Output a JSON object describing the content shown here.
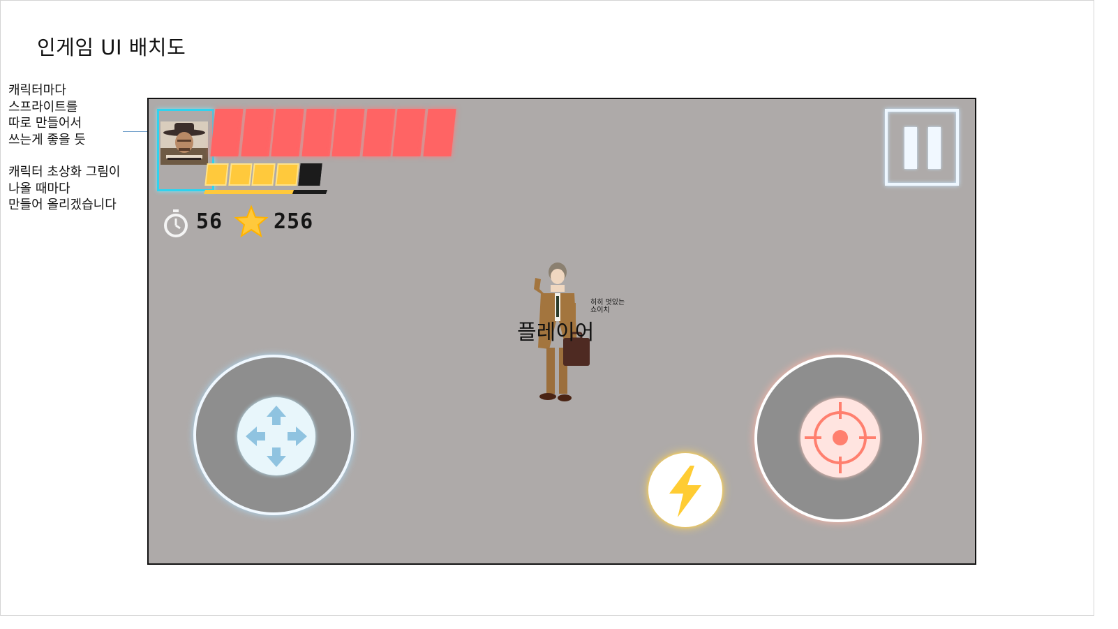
{
  "slide": {
    "title": "인게임 UI 배치도",
    "notes": [
      "캐릭터마다\n스프라이트를\n따로 만들어서\n쓰는게 좋을 듯",
      "캐릭터 초상화 그림이\n나올 때마다\n만들어 올리겠습니다"
    ]
  },
  "hud": {
    "health": {
      "filled": 8,
      "total": 8,
      "color": "#ff6464"
    },
    "mana": {
      "filled": 4,
      "total": 5,
      "color": "#ffc93c"
    },
    "timer_value": "56",
    "star_value": "256",
    "timer_icon": "stopwatch-icon",
    "star_icon": "star-icon",
    "pause_icon": "pause-icon"
  },
  "player": {
    "label": "플레이어",
    "quote": "히히 멋있는\n쇼이치"
  },
  "controls": {
    "move_icon": "four-way-arrows-icon",
    "attack_icon": "crosshair-icon",
    "skill_icon": "lightning-bolt-icon",
    "accent_move": "#8fc3e0",
    "accent_attack": "#ff7f6e",
    "accent_skill": "#ffcc33"
  }
}
